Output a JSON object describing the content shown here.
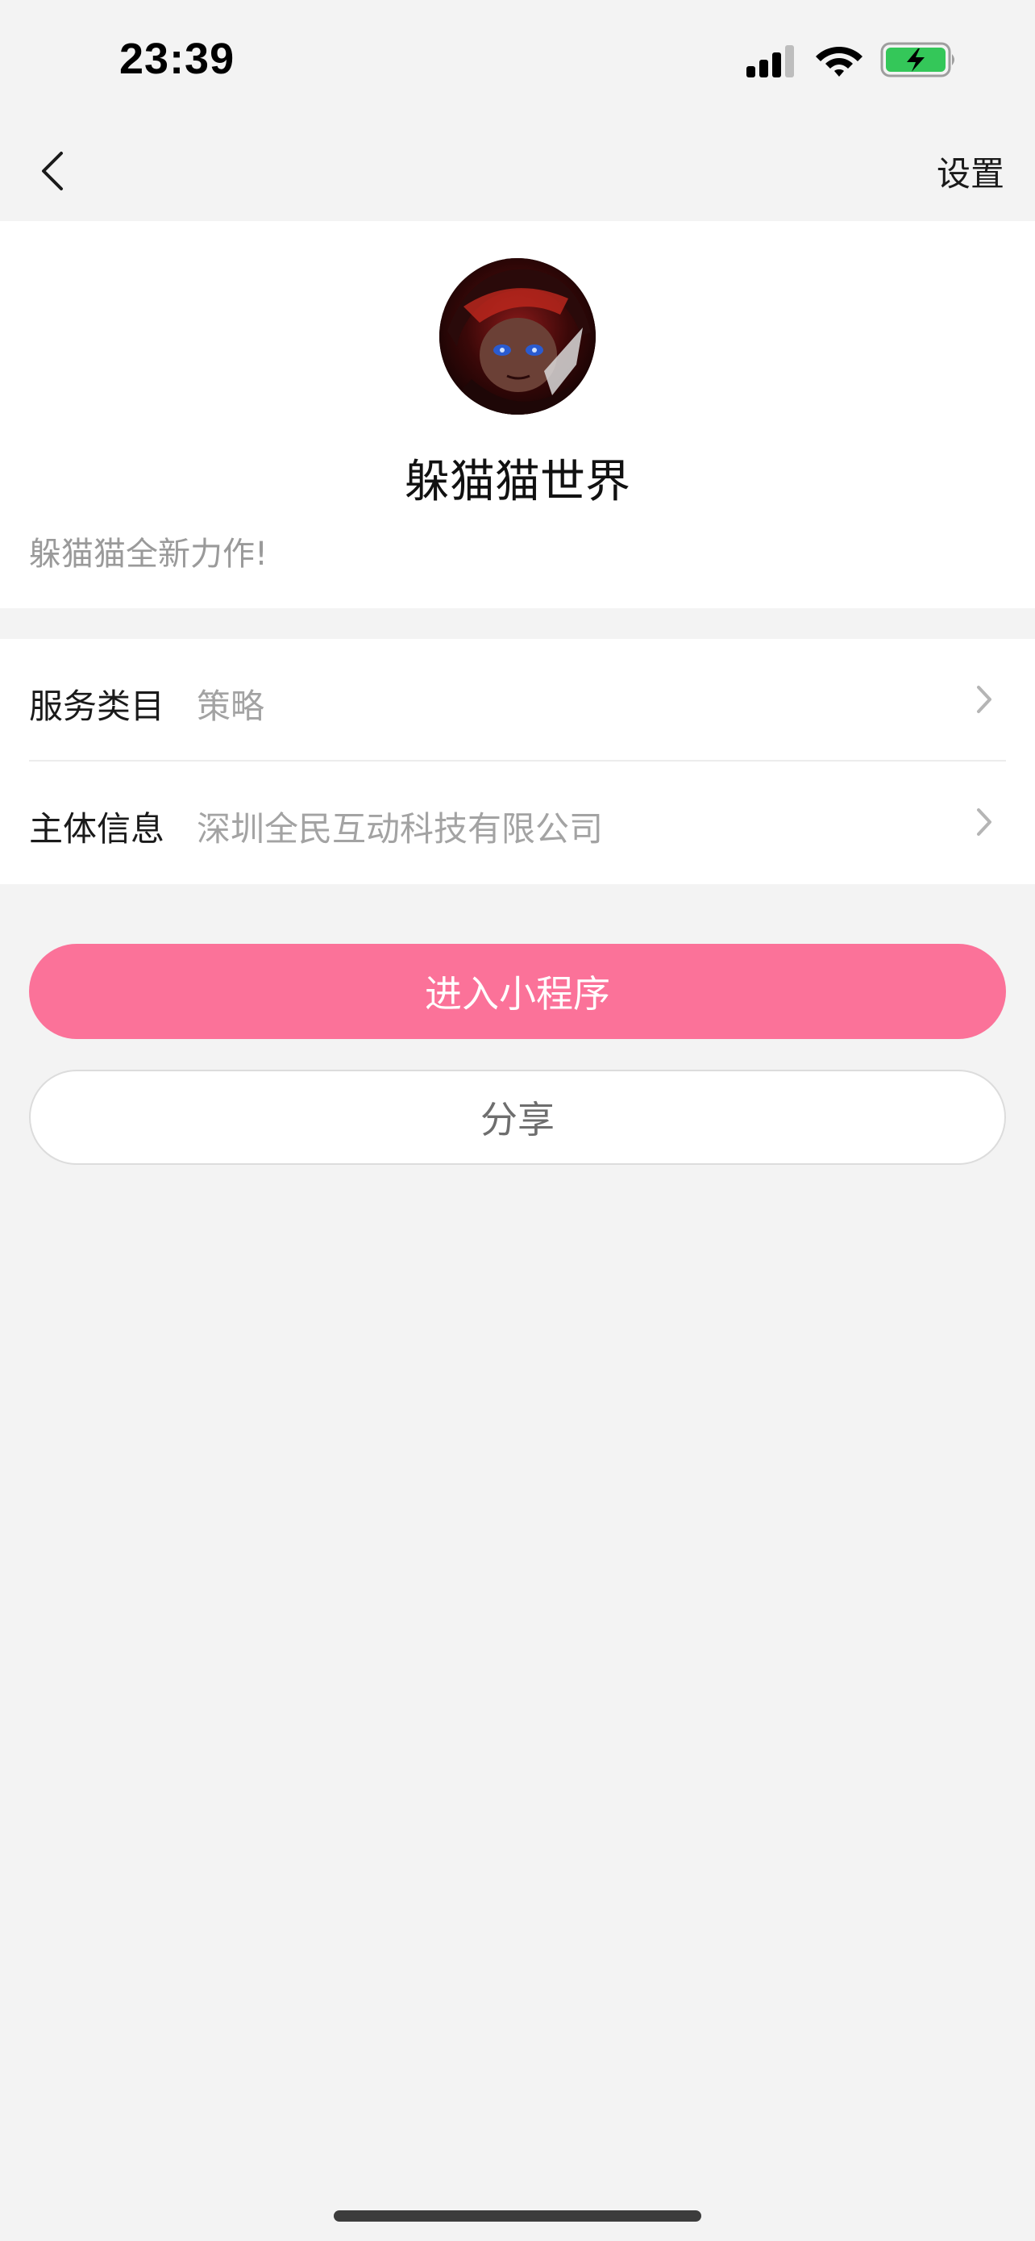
{
  "status_bar": {
    "time": "23:39",
    "icons": [
      "cellular-signal-icon",
      "wifi-icon",
      "battery-charging-icon"
    ],
    "battery_color": "#34c759"
  },
  "nav": {
    "back_icon": "chevron-left-icon",
    "settings_label": "设置"
  },
  "app": {
    "name": "躲猫猫世界",
    "description": "躲猫猫全新力作!"
  },
  "info": [
    {
      "label": "服务类目",
      "value": "策略"
    },
    {
      "label": "主体信息",
      "value": "深圳全民互动科技有限公司"
    }
  ],
  "buttons": {
    "enter_label": "进入小程序",
    "share_label": "分享"
  },
  "colors": {
    "accent": "#fb7299",
    "background": "#f3f3f3",
    "card": "#ffffff",
    "secondary_text": "#9a9a9a"
  }
}
